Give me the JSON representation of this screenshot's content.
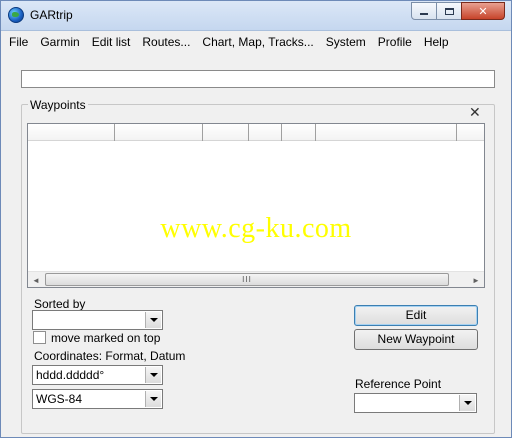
{
  "window": {
    "title": "GARtrip",
    "buttons": {
      "minimize": "minimize",
      "maximize": "maximize",
      "close": "close"
    }
  },
  "menu": [
    "File",
    "Garmin",
    "Edit list",
    "Routes...",
    "Chart, Map, Tracks...",
    "System",
    "Profile",
    "Help"
  ],
  "top_field": {
    "value": ""
  },
  "waypoints": {
    "legend": "Waypoints",
    "close_glyph": "✕",
    "watermark": "www.cg-ku.com",
    "columns": [
      "",
      "",
      "",
      "",
      "",
      "",
      ""
    ],
    "scroll_left": "◄",
    "scroll_right": "►",
    "scroll_grip": "III"
  },
  "sorted_by": {
    "label": "Sorted by",
    "value": ""
  },
  "move_marked": {
    "label": "move marked on top",
    "checked": false
  },
  "coordinates": {
    "label": "Coordinates: Format, Datum",
    "format": "hddd.ddddd°",
    "datum": "WGS-84"
  },
  "buttons": {
    "edit": "Edit",
    "new_waypoint": "New Waypoint"
  },
  "reference_point": {
    "label": "Reference Point",
    "value": ""
  },
  "icons": {
    "app": "globe-icon",
    "dropdown": "chevron-down-icon"
  }
}
